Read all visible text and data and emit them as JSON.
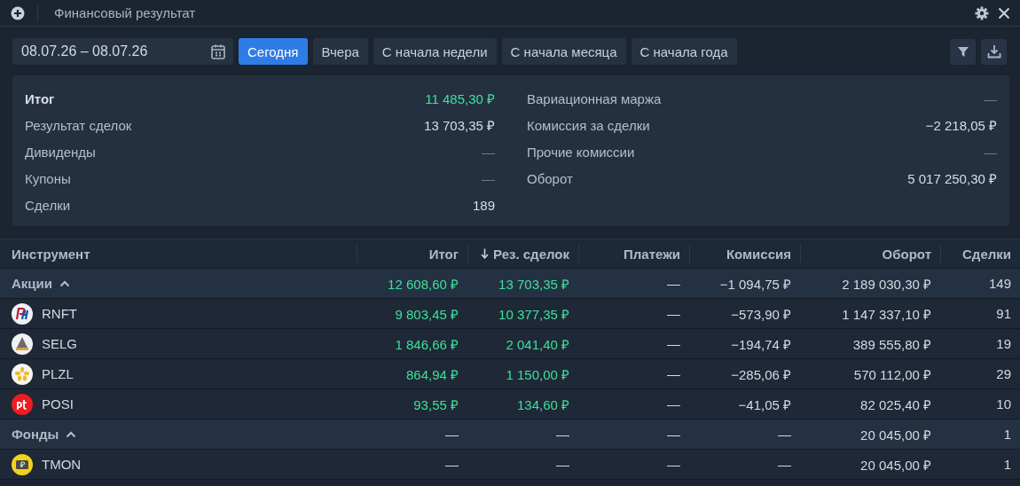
{
  "window": {
    "title": "Финансовый результат"
  },
  "date_range": {
    "value": "08.07.26 – 08.07.26"
  },
  "presets": [
    {
      "label": "Сегодня",
      "selected": true
    },
    {
      "label": "Вчера",
      "selected": false
    },
    {
      "label": "С начала недели",
      "selected": false
    },
    {
      "label": "С начала месяца",
      "selected": false
    },
    {
      "label": "С начала года",
      "selected": false
    }
  ],
  "summary": {
    "left": [
      {
        "label": "Итог",
        "value": "11 485,30 ₽",
        "kind": "total"
      },
      {
        "label": "Результат сделок",
        "value": "13 703,35 ₽",
        "kind": "plain"
      },
      {
        "label": "Дивиденды",
        "value": "—",
        "kind": "empty"
      },
      {
        "label": "Купоны",
        "value": "—",
        "kind": "empty"
      },
      {
        "label": "Сделки",
        "value": "189",
        "kind": "plain"
      }
    ],
    "right": [
      {
        "label": "Вариационная маржа",
        "value": "—",
        "kind": "empty"
      },
      {
        "label": "Комиссия за сделки",
        "value": "−2 218,05 ₽",
        "kind": "plain"
      },
      {
        "label": "Прочие комиссии",
        "value": "—",
        "kind": "empty"
      },
      {
        "label": "Оборот",
        "value": "5 017 250,30 ₽",
        "kind": "plain"
      }
    ]
  },
  "table": {
    "columns": [
      {
        "label": "Инструмент",
        "sorted": false
      },
      {
        "label": "Итог",
        "sorted": false
      },
      {
        "label": "Рез. сделок",
        "sorted": true
      },
      {
        "label": "Платежи",
        "sorted": false
      },
      {
        "label": "Комиссия",
        "sorted": false
      },
      {
        "label": "Оборот",
        "sorted": false
      },
      {
        "label": "Сделки",
        "sorted": false
      }
    ],
    "rows": [
      {
        "kind": "group",
        "expanded": true,
        "gain": true,
        "cells": [
          "Акции",
          "12 608,60 ₽",
          "13 703,35 ₽",
          "—",
          "−1 094,75 ₽",
          "2 189 030,30 ₽",
          "149"
        ]
      },
      {
        "kind": "instrument",
        "gain": true,
        "cells": [
          "RNFT",
          "9 803,45 ₽",
          "10 377,35 ₽",
          "—",
          "−573,90 ₽",
          "1 147 337,10 ₽",
          "91"
        ]
      },
      {
        "kind": "instrument",
        "gain": true,
        "cells": [
          "SELG",
          "1 846,66 ₽",
          "2 041,40 ₽",
          "—",
          "−194,74 ₽",
          "389 555,80 ₽",
          "19"
        ]
      },
      {
        "kind": "instrument",
        "gain": true,
        "cells": [
          "PLZL",
          "864,94 ₽",
          "1 150,00 ₽",
          "—",
          "−285,06 ₽",
          "570 112,00 ₽",
          "29"
        ]
      },
      {
        "kind": "instrument",
        "gain": true,
        "cells": [
          "POSI",
          "93,55 ₽",
          "134,60 ₽",
          "—",
          "−41,05 ₽",
          "82 025,40 ₽",
          "10"
        ]
      },
      {
        "kind": "group",
        "expanded": true,
        "gain": false,
        "cells": [
          "Фонды",
          "—",
          "—",
          "—",
          "—",
          "20 045,00 ₽",
          "1"
        ]
      },
      {
        "kind": "instrument",
        "gain": false,
        "cells": [
          "TMON",
          "—",
          "—",
          "—",
          "—",
          "20 045,00 ₽",
          "1"
        ]
      }
    ]
  }
}
